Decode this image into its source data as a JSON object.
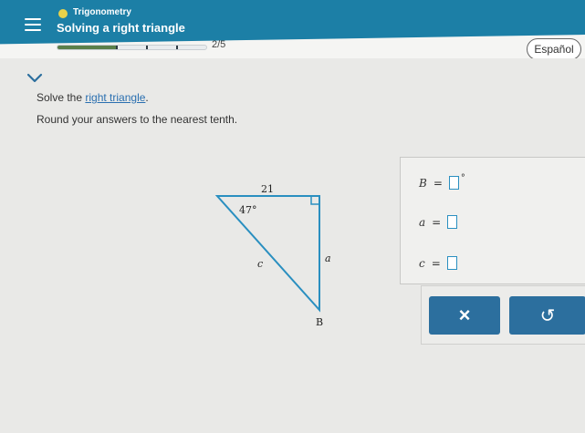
{
  "header": {
    "topic": "Trigonometry",
    "lesson": "Solving a right triangle",
    "progress_text": "2/5",
    "progress_fraction": 0.4,
    "accent_color": "#1c7fa6",
    "topic_dot_color": "#e8d24a"
  },
  "language_button": {
    "label": "Español"
  },
  "problem": {
    "instruction_prefix": "Solve the ",
    "instruction_link": "right triangle",
    "instruction_suffix": ".",
    "rounding": "Round your answers to the nearest tenth."
  },
  "triangle": {
    "side_top": "21",
    "angle_top_left": "47°",
    "hypotenuse": "c",
    "side_right": "a",
    "vertex_bottom": "B"
  },
  "answers": [
    {
      "variable": "B",
      "equals": "=",
      "unit": "°"
    },
    {
      "variable": "a",
      "equals": "=",
      "unit": ""
    },
    {
      "variable": "c",
      "equals": "=",
      "unit": ""
    }
  ],
  "actions": {
    "clear_icon": "×",
    "undo_icon": "↺"
  },
  "icons": {
    "menu": "hamburger-menu-icon",
    "collapse": "chevron-down-icon",
    "clear": "close-icon",
    "undo": "undo-icon"
  }
}
